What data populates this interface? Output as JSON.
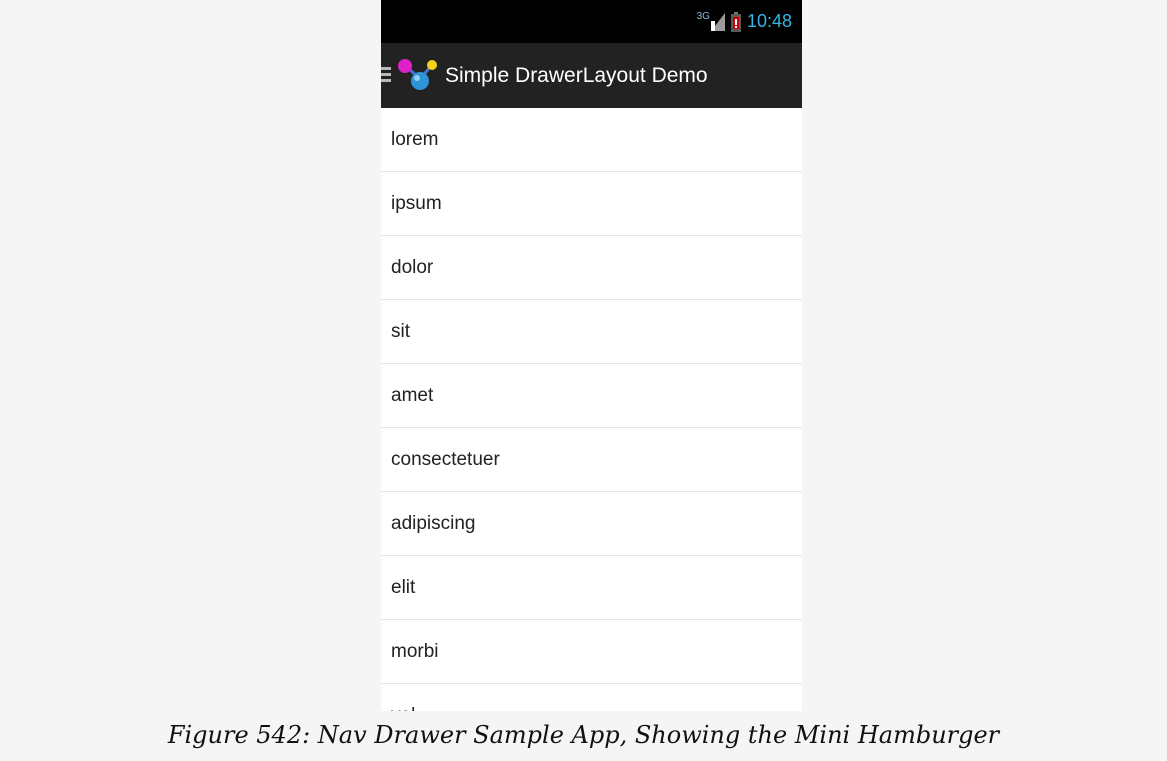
{
  "status_bar": {
    "network_label": "3G",
    "time": "10:48",
    "icons": [
      "signal-icon",
      "battery-icon"
    ]
  },
  "action_bar": {
    "title": "Simple DrawerLayout Demo",
    "icons": [
      "hamburger-icon",
      "app-icon"
    ]
  },
  "list": {
    "items": [
      "lorem",
      "ipsum",
      "dolor",
      "sit",
      "amet",
      "consectetuer",
      "adipiscing",
      "elit",
      "morbi",
      "vel"
    ]
  },
  "caption": "Figure 542: Nav Drawer Sample App, Showing the Mini Hamburger",
  "colors": {
    "status_bar_bg": "#000000",
    "action_bar_bg": "#222222",
    "clock": "#33b5e5",
    "battery_warning": "#cc0000",
    "list_bg": "#ffffff",
    "page_bg": "#f5f5f5"
  }
}
